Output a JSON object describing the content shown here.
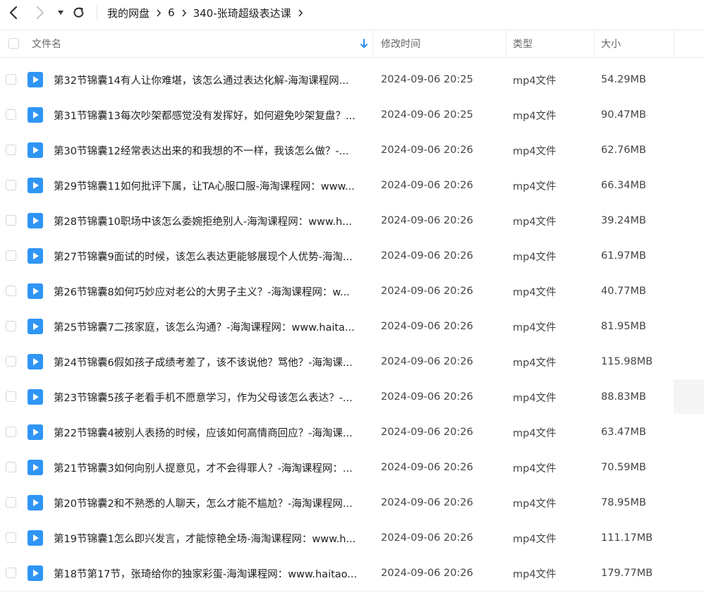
{
  "breadcrumb": [
    "我的网盘",
    "6",
    "340-张琦超级表达课"
  ],
  "columns": {
    "name": "文件名",
    "modified": "修改时间",
    "type": "类型",
    "size": "大小"
  },
  "files": [
    {
      "name": "第32节锦囊14有人让你难堪，该怎么通过表达化解-海淘课程网...",
      "date": "2024-09-06 20:25",
      "type": "mp4文件",
      "size": "54.29MB"
    },
    {
      "name": "第31节锦囊13每次吵架都感觉没有发挥好，如何避免吵架复盘？...",
      "date": "2024-09-06 20:25",
      "type": "mp4文件",
      "size": "90.47MB"
    },
    {
      "name": "第30节锦囊12经常表达出来的和我想的不一样，我该怎么做？-...",
      "date": "2024-09-06 20:26",
      "type": "mp4文件",
      "size": "62.76MB"
    },
    {
      "name": "第29节锦囊11如何批评下属，让TA心服口服-海淘课程网：www...",
      "date": "2024-09-06 20:26",
      "type": "mp4文件",
      "size": "66.34MB"
    },
    {
      "name": "第28节锦囊10职场中该怎么委婉拒绝别人-海淘课程网：www.h...",
      "date": "2024-09-06 20:26",
      "type": "mp4文件",
      "size": "39.24MB"
    },
    {
      "name": "第27节锦囊9面试的时候，该怎么表达更能够展现个人优势-海淘...",
      "date": "2024-09-06 20:26",
      "type": "mp4文件",
      "size": "61.97MB"
    },
    {
      "name": "第26节锦囊8如何巧妙应对老公的大男子主义？-海淘课程网：w...",
      "date": "2024-09-06 20:26",
      "type": "mp4文件",
      "size": "40.77MB"
    },
    {
      "name": "第25节锦囊7二孩家庭，该怎么沟通？-海淘课程网：www.haita...",
      "date": "2024-09-06 20:26",
      "type": "mp4文件",
      "size": "81.95MB"
    },
    {
      "name": "第24节锦囊6假如孩子成绩考差了，该不该说他？骂他？-海淘课...",
      "date": "2024-09-06 20:26",
      "type": "mp4文件",
      "size": "115.98MB"
    },
    {
      "name": "第23节锦囊5孩子老看手机不愿意学习，作为父母该怎么表达？-...",
      "date": "2024-09-06 20:26",
      "type": "mp4文件",
      "size": "88.83MB"
    },
    {
      "name": "第22节锦囊4被别人表扬的时候，应该如何高情商回应？-海淘课...",
      "date": "2024-09-06 20:26",
      "type": "mp4文件",
      "size": "63.47MB"
    },
    {
      "name": "第21节锦囊3如何向别人提意见，才不会得罪人？-海淘课程网：...",
      "date": "2024-09-06 20:26",
      "type": "mp4文件",
      "size": "70.59MB"
    },
    {
      "name": "第20节锦囊2和不熟悉的人聊天，怎么才能不尴尬？-海淘课程网...",
      "date": "2024-09-06 20:26",
      "type": "mp4文件",
      "size": "78.95MB"
    },
    {
      "name": "第19节锦囊1怎么即兴发言，才能惊艳全场-海淘课程网：www.h...",
      "date": "2024-09-06 20:26",
      "type": "mp4文件",
      "size": "111.17MB"
    },
    {
      "name": "第18节第17节，张琦给你的独家彩蛋-海淘课程网：www.haitao...",
      "date": "2024-09-06 20:26",
      "type": "mp4文件",
      "size": "179.77MB"
    }
  ]
}
